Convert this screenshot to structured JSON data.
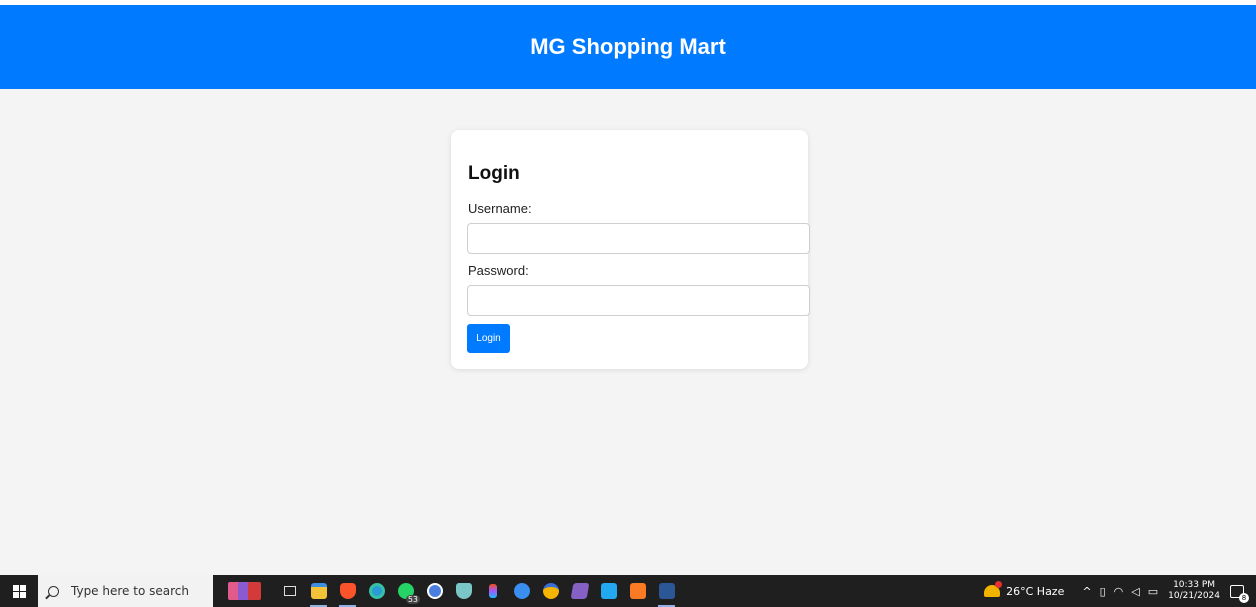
{
  "header": {
    "title": "MG Shopping Mart",
    "bg_color": "#007bff"
  },
  "login": {
    "title": "Login",
    "username_label": "Username:",
    "username_value": "",
    "password_label": "Password:",
    "password_value": "",
    "submit_label": "Login"
  },
  "taskbar": {
    "search_placeholder": "Type here to search",
    "apps": [
      {
        "name": "task-view-icon"
      },
      {
        "name": "file-explorer-icon"
      },
      {
        "name": "brave-browser-icon"
      },
      {
        "name": "edge-browser-icon"
      },
      {
        "name": "whatsapp-icon",
        "badge": "53"
      },
      {
        "name": "app-a-icon"
      },
      {
        "name": "app-shield-icon"
      },
      {
        "name": "figma-icon"
      },
      {
        "name": "app-play-icon"
      },
      {
        "name": "app-medal-icon"
      },
      {
        "name": "visual-studio-icon"
      },
      {
        "name": "vscode-icon"
      },
      {
        "name": "xampp-icon"
      },
      {
        "name": "word-icon"
      }
    ],
    "weather": "26°C  Haze",
    "time": "10:33 PM",
    "date": "10/21/2024",
    "notification_count": "8"
  }
}
